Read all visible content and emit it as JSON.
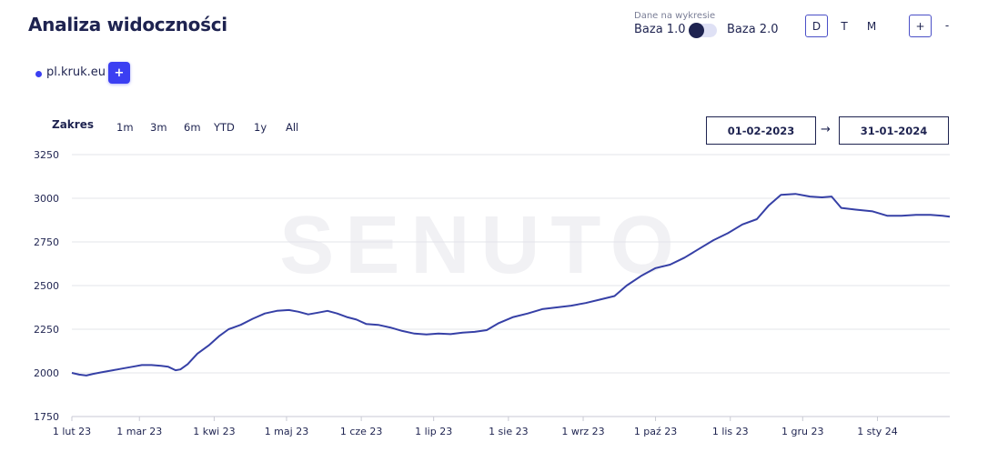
{
  "header": {
    "title": "Analiza widoczności",
    "data_source_caption": "Dane na wykresie",
    "base1_label": "Baza 1.0",
    "base2_label": "Baza 2.0",
    "granularity": [
      "D",
      "T",
      "M"
    ],
    "granularity_selected": "D",
    "zoom_in_label": "+",
    "zoom_out_label": "-"
  },
  "domain": {
    "name": "pl.kruk.eu",
    "color": "#3b3ff2",
    "add_label": "+"
  },
  "range": {
    "label": "Zakres",
    "options": [
      "1m",
      "3m",
      "6m",
      "YTD",
      "1y",
      "All"
    ],
    "start_date": "01-02-2023",
    "end_date": "31-01-2024",
    "arrow": "→"
  },
  "watermark": "SENUTO",
  "chart_data": {
    "type": "line",
    "x_type": "date",
    "xlim": [
      "2023-02-01",
      "2024-01-31"
    ],
    "ylim": [
      1750,
      3250
    ],
    "y_ticks": [
      1750,
      2000,
      2250,
      2500,
      2750,
      3000,
      3250
    ],
    "x_ticks": [
      {
        "date": "2023-02-01",
        "label": "1 lut 23"
      },
      {
        "date": "2023-03-01",
        "label": "1 mar 23"
      },
      {
        "date": "2023-04-01",
        "label": "1 kwi 23"
      },
      {
        "date": "2023-05-01",
        "label": "1 maj 23"
      },
      {
        "date": "2023-06-01",
        "label": "1 cze 23"
      },
      {
        "date": "2023-07-01",
        "label": "1 lip 23"
      },
      {
        "date": "2023-08-01",
        "label": "1 sie 23"
      },
      {
        "date": "2023-09-01",
        "label": "1 wrz 23"
      },
      {
        "date": "2023-10-01",
        "label": "1 paź 23"
      },
      {
        "date": "2023-11-01",
        "label": "1 lis 23"
      },
      {
        "date": "2023-12-01",
        "label": "1 gru 23"
      },
      {
        "date": "2024-01-01",
        "label": "1 sty 24"
      }
    ],
    "grid": true,
    "line_color": "#3640a6",
    "series": [
      {
        "name": "pl.kruk.eu",
        "points": [
          [
            "2023-02-01",
            2000
          ],
          [
            "2023-02-04",
            1990
          ],
          [
            "2023-02-07",
            1985
          ],
          [
            "2023-02-10",
            1995
          ],
          [
            "2023-02-14",
            2005
          ],
          [
            "2023-02-18",
            2015
          ],
          [
            "2023-02-22",
            2025
          ],
          [
            "2023-02-26",
            2035
          ],
          [
            "2023-03-02",
            2045
          ],
          [
            "2023-03-06",
            2045
          ],
          [
            "2023-03-10",
            2040
          ],
          [
            "2023-03-13",
            2035
          ],
          [
            "2023-03-16",
            2015
          ],
          [
            "2023-03-18",
            2020
          ],
          [
            "2023-03-21",
            2050
          ],
          [
            "2023-03-25",
            2110
          ],
          [
            "2023-03-30",
            2160
          ],
          [
            "2023-04-03",
            2210
          ],
          [
            "2023-04-07",
            2250
          ],
          [
            "2023-04-12",
            2275
          ],
          [
            "2023-04-17",
            2310
          ],
          [
            "2023-04-22",
            2340
          ],
          [
            "2023-04-27",
            2355
          ],
          [
            "2023-05-02",
            2360
          ],
          [
            "2023-05-06",
            2350
          ],
          [
            "2023-05-10",
            2335
          ],
          [
            "2023-05-14",
            2345
          ],
          [
            "2023-05-18",
            2355
          ],
          [
            "2023-05-22",
            2340
          ],
          [
            "2023-05-26",
            2320
          ],
          [
            "2023-05-30",
            2305
          ],
          [
            "2023-06-03",
            2280
          ],
          [
            "2023-06-08",
            2275
          ],
          [
            "2023-06-13",
            2260
          ],
          [
            "2023-06-18",
            2240
          ],
          [
            "2023-06-23",
            2225
          ],
          [
            "2023-06-28",
            2220
          ],
          [
            "2023-07-03",
            2225
          ],
          [
            "2023-07-08",
            2222
          ],
          [
            "2023-07-13",
            2230
          ],
          [
            "2023-07-18",
            2235
          ],
          [
            "2023-07-23",
            2245
          ],
          [
            "2023-07-28",
            2285
          ],
          [
            "2023-08-03",
            2320
          ],
          [
            "2023-08-09",
            2340
          ],
          [
            "2023-08-15",
            2365
          ],
          [
            "2023-08-21",
            2375
          ],
          [
            "2023-08-27",
            2385
          ],
          [
            "2023-09-02",
            2400
          ],
          [
            "2023-09-08",
            2420
          ],
          [
            "2023-09-14",
            2440
          ],
          [
            "2023-09-19",
            2500
          ],
          [
            "2023-09-25",
            2555
          ],
          [
            "2023-10-01",
            2600
          ],
          [
            "2023-10-07",
            2620
          ],
          [
            "2023-10-13",
            2660
          ],
          [
            "2023-10-19",
            2710
          ],
          [
            "2023-10-25",
            2760
          ],
          [
            "2023-10-31",
            2800
          ],
          [
            "2023-11-06",
            2850
          ],
          [
            "2023-11-12",
            2880
          ],
          [
            "2023-11-17",
            2960
          ],
          [
            "2023-11-22",
            3020
          ],
          [
            "2023-11-28",
            3025
          ],
          [
            "2023-12-04",
            3010
          ],
          [
            "2023-12-09",
            3005
          ],
          [
            "2023-12-13",
            3010
          ],
          [
            "2023-12-17",
            2945
          ],
          [
            "2023-12-23",
            2935
          ],
          [
            "2023-12-30",
            2925
          ],
          [
            "2024-01-05",
            2900
          ],
          [
            "2024-01-11",
            2900
          ],
          [
            "2024-01-17",
            2905
          ],
          [
            "2024-01-23",
            2905
          ],
          [
            "2024-01-28",
            2900
          ],
          [
            "2024-01-31",
            2895
          ]
        ]
      }
    ]
  }
}
